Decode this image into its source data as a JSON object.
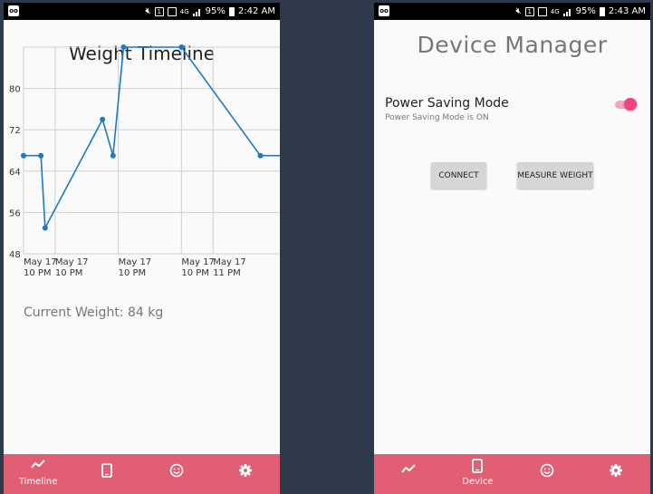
{
  "left_screen": {
    "status_bar": {
      "app_badge": "oo",
      "network": "4G",
      "battery": "95%",
      "time": "2:42 AM"
    },
    "chart_title": "Weight Timeline",
    "current_weight": "Current Weight: 84 kg",
    "nav": {
      "items": [
        {
          "icon": "timeline-icon",
          "label": "Timeline",
          "active": true
        },
        {
          "icon": "phone-icon",
          "label": "",
          "active": false
        },
        {
          "icon": "smiley-icon",
          "label": "",
          "active": false
        },
        {
          "icon": "gear-icon",
          "label": "",
          "active": false
        }
      ]
    }
  },
  "right_screen": {
    "status_bar": {
      "app_badge": "oo",
      "network": "4G",
      "battery": "95%",
      "time": "2:43 AM"
    },
    "title": "Device Manager",
    "power_saving": {
      "label": "Power Saving Mode",
      "status": "Power Saving Mode is ON",
      "enabled": true
    },
    "buttons": {
      "connect": "CONNECT",
      "measure": "MEASURE WEIGHT"
    },
    "nav": {
      "items": [
        {
          "icon": "timeline-icon",
          "label": "",
          "active": false
        },
        {
          "icon": "phone-icon",
          "label": "Device",
          "active": true
        },
        {
          "icon": "smiley-icon",
          "label": "",
          "active": false
        },
        {
          "icon": "gear-icon",
          "label": "",
          "active": false
        }
      ]
    }
  },
  "colors": {
    "accent": "#e05f74",
    "line": "#1a7ac4",
    "toggle_thumb": "#f2447a",
    "toggle_track": "#f6a6c2"
  },
  "chart_data": {
    "type": "line",
    "title": "Weight Timeline",
    "xlabel": "",
    "ylabel": "",
    "ylim": [
      48,
      88
    ],
    "yticks": [
      "48",
      "56",
      "64",
      "72",
      "80"
    ],
    "xticks": [
      {
        "x": 0,
        "line1": "May 17",
        "line2": "10 PM"
      },
      {
        "x": 6,
        "line1": "May 17",
        "line2": "10 PM"
      },
      {
        "x": 18,
        "line1": "May 17",
        "line2": "10 PM"
      },
      {
        "x": 30,
        "line1": "May 17",
        "line2": "10 PM"
      },
      {
        "x": 36,
        "line1": "May 17",
        "line2": "11 PM"
      }
    ],
    "xlim": [
      0,
      48.7
    ],
    "grid": true,
    "series": [
      {
        "x": [
          0,
          3.3,
          4.1,
          15,
          17,
          19,
          30,
          45,
          48.7
        ],
        "y": [
          67,
          67,
          53,
          74,
          67,
          88,
          88,
          67,
          67
        ],
        "points": [
          true,
          true,
          true,
          true,
          true,
          true,
          true,
          true,
          false
        ]
      }
    ]
  }
}
